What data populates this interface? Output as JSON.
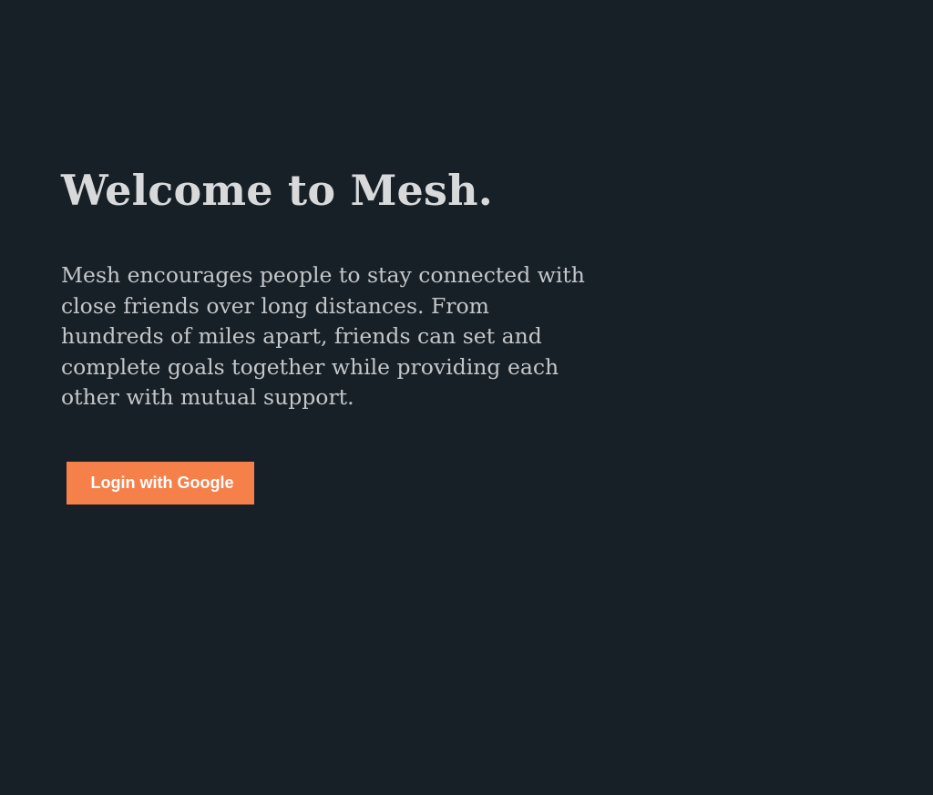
{
  "welcome": {
    "title": "Welcome to Mesh.",
    "description": "Mesh encourages people to stay connected with close friends over long distances. From hundreds of miles apart, friends can set and complete goals together while providing each other with mutual support."
  },
  "auth": {
    "login_button_label": "Login with Google"
  },
  "theme": {
    "background": "#182027",
    "accent": "#f5804a",
    "title_color": "#d7d9da",
    "text_color": "#c3c7ca"
  }
}
